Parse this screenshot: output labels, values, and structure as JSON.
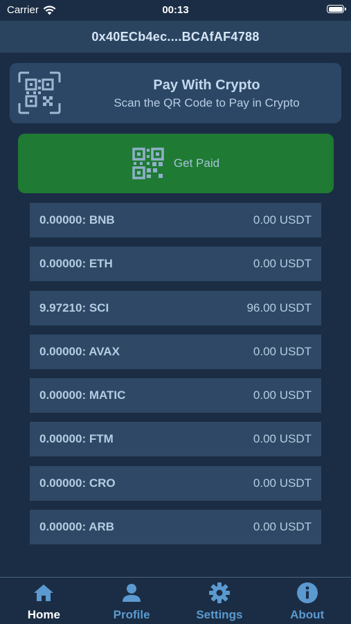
{
  "status_bar": {
    "carrier": "Carrier",
    "time": "00:13"
  },
  "header": {
    "address": "0x40ECb4ec....BCAfAF4788"
  },
  "pay_card": {
    "title": "Pay With Crypto",
    "subtitle": "Scan the QR Code to Pay in Crypto",
    "icon": "qr-code-icon"
  },
  "get_paid": {
    "label": "Get Paid",
    "icon": "qr-code-icon",
    "color": "#1f7a34"
  },
  "tokens": [
    {
      "amount": "0.00000: BNB",
      "value": "0.00 USDT"
    },
    {
      "amount": "0.00000: ETH",
      "value": "0.00 USDT"
    },
    {
      "amount": "9.97210: SCI",
      "value": "96.00 USDT"
    },
    {
      "amount": "0.00000: AVAX",
      "value": "0.00 USDT"
    },
    {
      "amount": "0.00000: MATIC",
      "value": "0.00 USDT"
    },
    {
      "amount": "0.00000: FTM",
      "value": "0.00 USDT"
    },
    {
      "amount": "0.00000: CRO",
      "value": "0.00 USDT"
    },
    {
      "amount": "0.00000: ARB",
      "value": "0.00 USDT"
    }
  ],
  "tab_bar": {
    "tabs": [
      {
        "label": "Home",
        "icon": "home-icon",
        "active": true
      },
      {
        "label": "Profile",
        "icon": "person-icon",
        "active": false
      },
      {
        "label": "Settings",
        "icon": "gear-icon",
        "active": false
      },
      {
        "label": "About",
        "icon": "info-icon",
        "active": false
      }
    ]
  },
  "colors": {
    "background": "#1b2d44",
    "accent": "#5b9ad0",
    "active_tab": "#ffffff"
  }
}
